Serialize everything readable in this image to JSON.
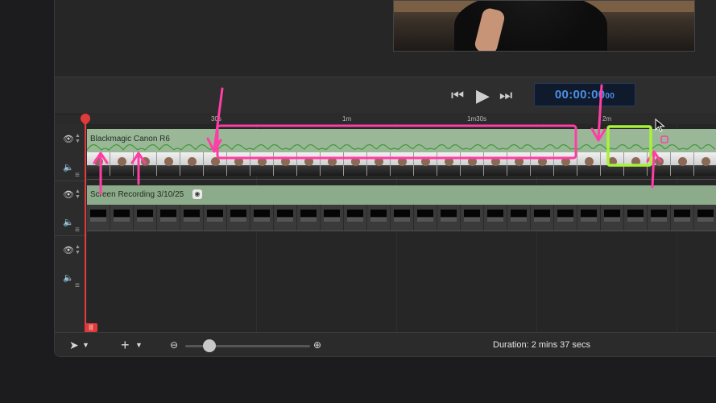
{
  "transport": {
    "prev_icon": "skip-back-icon",
    "play_icon": "play-icon",
    "next_icon": "skip-forward-icon",
    "timecode_main": "00:00:00",
    "timecode_frames": "00"
  },
  "ruler": {
    "ticks": [
      "30s",
      "1m",
      "1m30s",
      "2m"
    ]
  },
  "tracks": [
    {
      "clip_title": "Blackmagic Canon R6",
      "visibility_icon": "eye-icon",
      "audio_icon": "speaker-icon"
    },
    {
      "clip_title": "Screen Recording 3/10/25",
      "visibility_icon": "eye-icon",
      "audio_icon": "speaker-icon"
    },
    {
      "clip_title": "",
      "visibility_icon": "eye-icon",
      "audio_icon": "speaker-icon"
    }
  ],
  "bottom_bar": {
    "select_tool_icon": "arrow-cursor-icon",
    "add_icon": "plus-icon",
    "zoom_out_icon": "zoom-out-icon",
    "zoom_in_icon": "zoom-in-icon",
    "zoom_level": 0.2,
    "duration": "Duration: 2 mins 37 secs"
  },
  "colors": {
    "clip_green": "#8cab8a",
    "playhead": "#e23a3a",
    "annotation_pink": "#ff3ea5",
    "annotation_lime": "#a8f23a",
    "timecode_blue": "#4f8fe6"
  }
}
